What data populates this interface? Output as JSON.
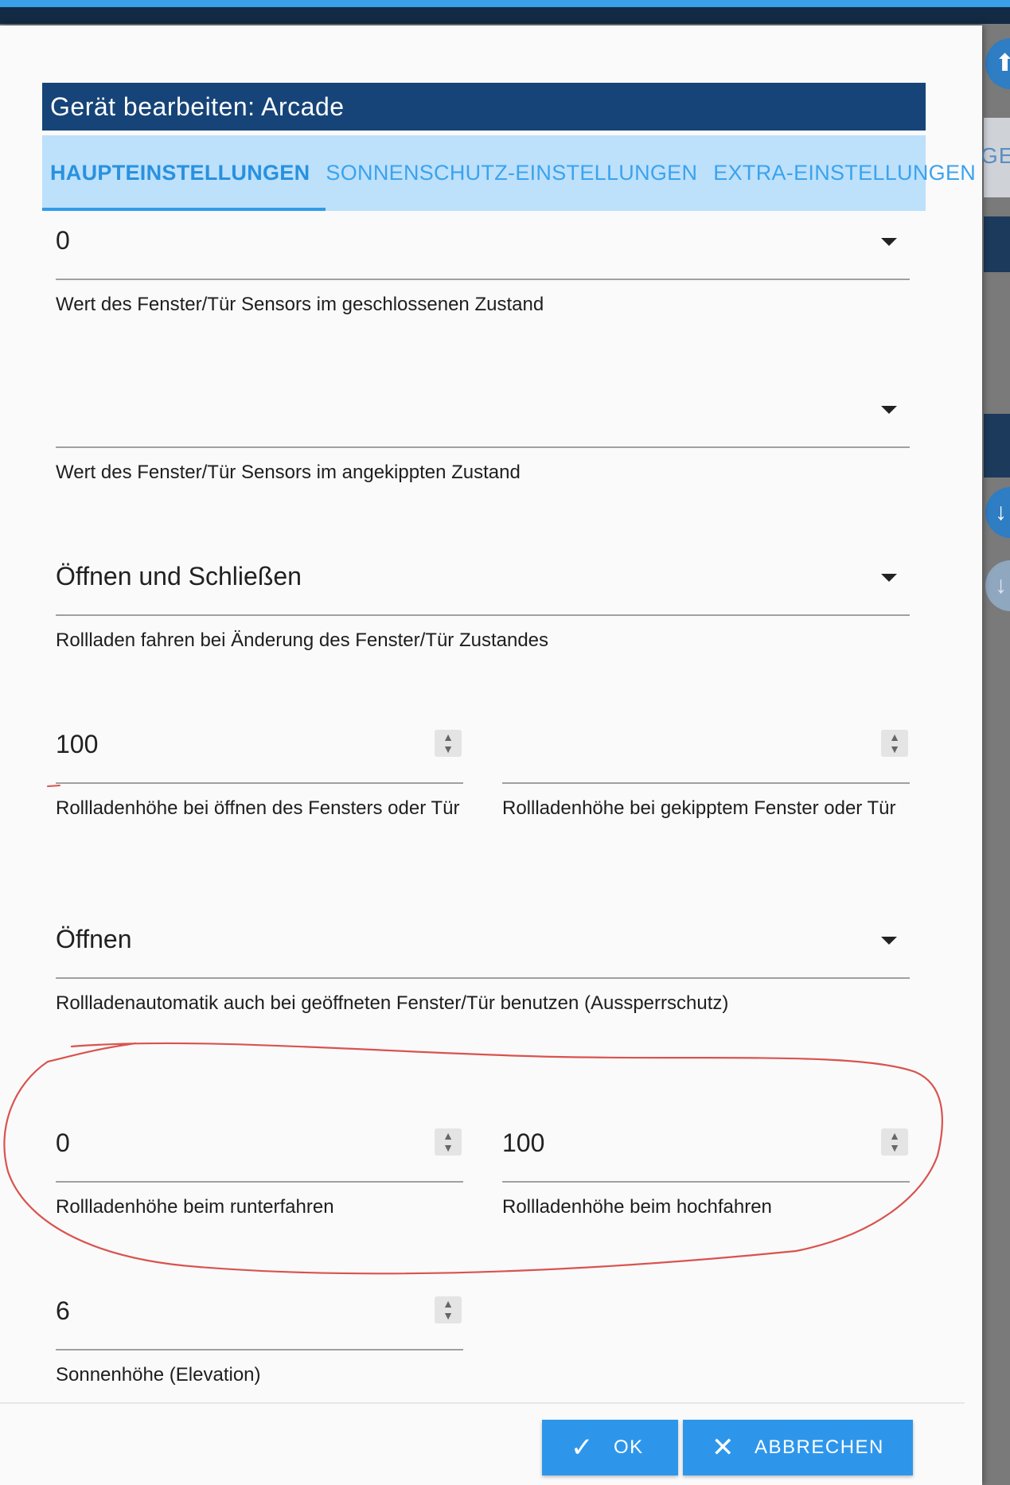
{
  "dialog": {
    "title": "Gerät bearbeiten: Arcade",
    "tabs": [
      {
        "label": "HAUPTEINSTELLUNGEN",
        "active": true
      },
      {
        "label": "SONNENSCHUTZ-EINSTELLUNGEN",
        "active": false
      },
      {
        "label": "EXTRA-EINSTELLUNGEN",
        "active": false
      }
    ]
  },
  "fields": {
    "closed_value": {
      "value": "0",
      "helper": "Wert des Fenster/Tür Sensors im geschlossenen Zustand"
    },
    "tilted_value": {
      "value": "",
      "helper": "Wert des Fenster/Tür Sensors im angekippten Zustand"
    },
    "change_mode": {
      "value": "Öffnen und Schließen",
      "helper": "Rollladen fahren bei Änderung des Fenster/Tür Zustandes"
    },
    "height_open": {
      "value": "100",
      "helper": "Rollladenhöhe bei öffnen des Fensters oder Tür"
    },
    "height_tilted": {
      "value": "",
      "helper": "Rollladenhöhe bei gekipptem Fenster oder Tür"
    },
    "lockout": {
      "value": "Öffnen",
      "helper": "Rollladenautomatik auch bei geöffneten Fenster/Tür benutzen (Aussperrschutz)"
    },
    "height_down": {
      "value": "0",
      "helper": "Rollladenhöhe beim runterfahren"
    },
    "height_up": {
      "value": "100",
      "helper": "Rollladenhöhe beim hochfahren"
    },
    "elevation": {
      "value": "6",
      "helper": "Sonnenhöhe (Elevation)"
    }
  },
  "buttons": {
    "ok": "OK",
    "cancel": "ABBRECHEN"
  },
  "background": {
    "partial_text": "GE"
  },
  "colors": {
    "title_bg": "#164478",
    "tabs_bg": "#bde0fb",
    "accent": "#2e96ea",
    "annotation": "#d9534f"
  }
}
